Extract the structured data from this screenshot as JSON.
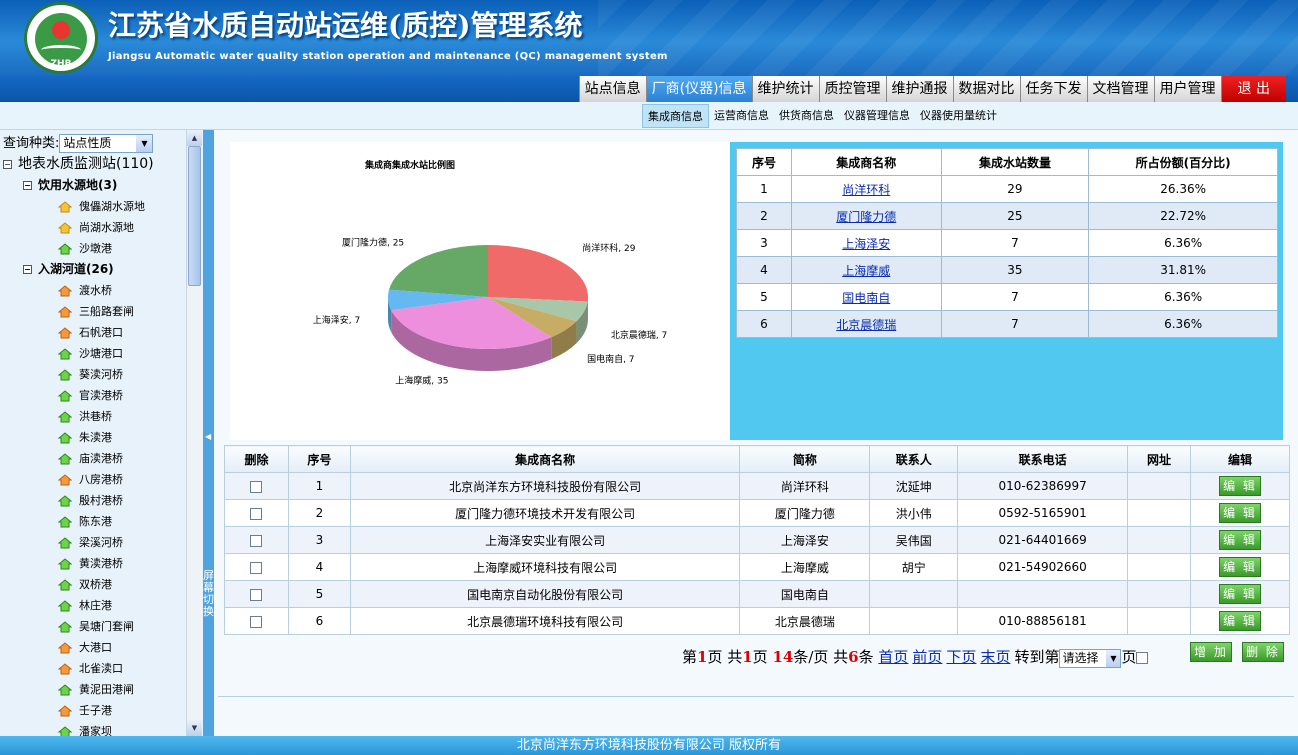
{
  "header": {
    "logo_text": "ZHB",
    "title": "江苏省水质自动站运维(质控)管理系统",
    "subtitle": "Jiangsu Automatic water quality station operation and maintenance (QC) management system"
  },
  "main_nav": [
    "站点信息",
    "厂商(仪器)信息",
    "维护统计",
    "质控管理",
    "维护通报",
    "数据对比",
    "任务下发",
    "文档管理",
    "用户管理",
    "退  出"
  ],
  "main_nav_active": 1,
  "sub_nav": [
    "集成商信息",
    "运营商信息",
    "供货商信息",
    "仪器管理信息",
    "仪器使用量统计"
  ],
  "sub_nav_active": 0,
  "sidebar": {
    "query_label": "查询种类:",
    "query_value": "站点性质",
    "root": "地表水质监测站(110)",
    "groups": [
      {
        "name": "饮用水源地(3)",
        "items": [
          {
            "name": "傀儡湖水源地",
            "icon": "yellow"
          },
          {
            "name": "尚湖水源地",
            "icon": "yellow"
          },
          {
            "name": "沙墩港",
            "icon": "green"
          }
        ]
      },
      {
        "name": "入湖河道(26)",
        "items": [
          {
            "name": "渡水桥",
            "icon": "orange"
          },
          {
            "name": "三船路套闸",
            "icon": "orange"
          },
          {
            "name": "石帆港口",
            "icon": "orange"
          },
          {
            "name": "沙塘港口",
            "icon": "green"
          },
          {
            "name": "葵渎河桥",
            "icon": "green"
          },
          {
            "name": "官渎港桥",
            "icon": "green"
          },
          {
            "name": "洪巷桥",
            "icon": "green"
          },
          {
            "name": "朱渎港",
            "icon": "green"
          },
          {
            "name": "庙渎港桥",
            "icon": "green"
          },
          {
            "name": "八房港桥",
            "icon": "orange"
          },
          {
            "name": "殷村港桥",
            "icon": "green"
          },
          {
            "name": "陈东港",
            "icon": "green"
          },
          {
            "name": "梁溪河桥",
            "icon": "green"
          },
          {
            "name": "黄渎港桥",
            "icon": "green"
          },
          {
            "name": "双桥港",
            "icon": "green"
          },
          {
            "name": "林庄港",
            "icon": "green"
          },
          {
            "name": "吴塘门套闸",
            "icon": "green"
          },
          {
            "name": "大港口",
            "icon": "orange"
          },
          {
            "name": "北雀渎口",
            "icon": "orange"
          },
          {
            "name": "黄泥田港闸",
            "icon": "green"
          },
          {
            "name": "壬子港",
            "icon": "orange"
          },
          {
            "name": "潘家坝",
            "icon": "green"
          }
        ]
      }
    ]
  },
  "splitter_text": "屏幕切换",
  "chart_data": {
    "type": "pie",
    "title": "集成商集成水站比例图",
    "slices": [
      {
        "label": "尚洋环科",
        "value": 29,
        "color": "#f06a6a"
      },
      {
        "label": "北京晨德瑞",
        "value": 7,
        "color": "#a8c7a8"
      },
      {
        "label": "国电南自",
        "value": 7,
        "color": "#c7ac66"
      },
      {
        "label": "上海摩威",
        "value": 35,
        "color": "#ee8fdd"
      },
      {
        "label": "上海泽安",
        "value": 7,
        "color": "#66b9f0"
      },
      {
        "label": "厦门隆力德",
        "value": 25,
        "color": "#66a866"
      }
    ]
  },
  "summary_table": {
    "headers": [
      "序号",
      "集成商名称",
      "集成水站数量",
      "所占份额(百分比)"
    ],
    "rows": [
      [
        "1",
        "尚洋环科",
        "29",
        "26.36%"
      ],
      [
        "2",
        "厦门隆力德",
        "25",
        "22.72%"
      ],
      [
        "3",
        "上海泽安",
        "7",
        "6.36%"
      ],
      [
        "4",
        "上海摩威",
        "35",
        "31.81%"
      ],
      [
        "5",
        "国电南自",
        "7",
        "6.36%"
      ],
      [
        "6",
        "北京晨德瑞",
        "7",
        "6.36%"
      ]
    ]
  },
  "detail_table": {
    "headers": [
      "删除",
      "序号",
      "集成商名称",
      "简称",
      "联系人",
      "联系电话",
      "网址",
      "编辑"
    ],
    "edit_label": "编 辑",
    "rows": [
      [
        "1",
        "北京尚洋东方环境科技股份有限公司",
        "尚洋环科",
        "沈延坤",
        "010-62386997",
        ""
      ],
      [
        "2",
        "厦门隆力德环境技术开发有限公司",
        "厦门隆力德",
        "洪小伟",
        "0592-5165901",
        ""
      ],
      [
        "3",
        "上海泽安实业有限公司",
        "上海泽安",
        "吴伟国",
        "021-64401669",
        ""
      ],
      [
        "4",
        "上海摩威环境科技有限公司",
        "上海摩威",
        "胡宁",
        "021-54902660",
        ""
      ],
      [
        "5",
        "国电南京自动化股份有限公司",
        "国电南自",
        "",
        "",
        ""
      ],
      [
        "6",
        "北京晨德瑞环境科技有限公司",
        "北京晨德瑞",
        "",
        "010-88856181",
        ""
      ]
    ]
  },
  "pager": {
    "p1": "第",
    "cur": "1",
    "p2": "页 共",
    "total": "1",
    "p3": "页 ",
    "per": "14",
    "p4": "条/页 共",
    "count": "6",
    "p5": "条",
    "first": "首页",
    "prev": "前页",
    "next": "下页",
    "last": "末页",
    "goto": "转到第",
    "select": "请选择",
    "page": "页"
  },
  "buttons": {
    "add": "增 加",
    "delete": "删 除"
  },
  "footer": "北京尚洋东方环境科技股份有限公司 版权所有"
}
